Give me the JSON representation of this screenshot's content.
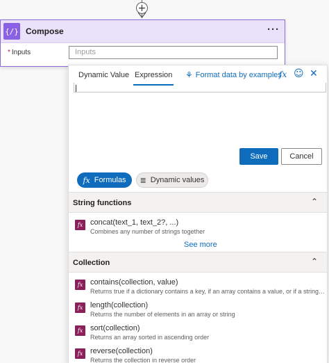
{
  "compose": {
    "icon_glyph": "{/}",
    "title": "Compose",
    "more": "···",
    "inputs_required_mark": "*",
    "inputs_label": "Inputs",
    "inputs_placeholder": "Inputs"
  },
  "connector": {
    "plus": "+"
  },
  "panel": {
    "tabs": [
      {
        "label": "Dynamic Value",
        "active": false
      },
      {
        "label": "Expression",
        "active": true
      }
    ],
    "format_link": "Format data by examples",
    "header_icons": [
      "fx-icon",
      "smiley-feedback-icon",
      "close-icon"
    ],
    "fx_glyph": "fx",
    "smile_glyph": "☺",
    "close_glyph": "✕",
    "expression_value": "",
    "save_label": "Save",
    "cancel_label": "Cancel",
    "pills": {
      "formulas": {
        "icon": "fx",
        "label": "Formulas",
        "active": true
      },
      "dynamic": {
        "icon": "≣",
        "label": "Dynamic values",
        "active": false
      }
    },
    "sections": [
      {
        "title": "String functions",
        "chevron": "⌃",
        "items": [
          {
            "name": "concat(text_1, text_2?, ...)",
            "desc": "Combines any number of strings together"
          }
        ],
        "see_more": "See more"
      },
      {
        "title": "Collection",
        "chevron": "⌃",
        "items": [
          {
            "name": "contains(collection, value)",
            "desc": "Returns true if a dictionary contains a key, if an array contains a value, or if a string contains a substring"
          },
          {
            "name": "length(collection)",
            "desc": "Returns the number of elements in an array or string"
          },
          {
            "name": "sort(collection)",
            "desc": "Returns an array sorted in ascending order"
          },
          {
            "name": "reverse(collection)",
            "desc": "Returns the collection in reverse order"
          }
        ]
      }
    ],
    "fn_icon_glyph": "fx"
  },
  "colors": {
    "accent": "#0f6cbd",
    "compose_purple": "#8a60e4",
    "function_icon": "#8a1f5a"
  }
}
